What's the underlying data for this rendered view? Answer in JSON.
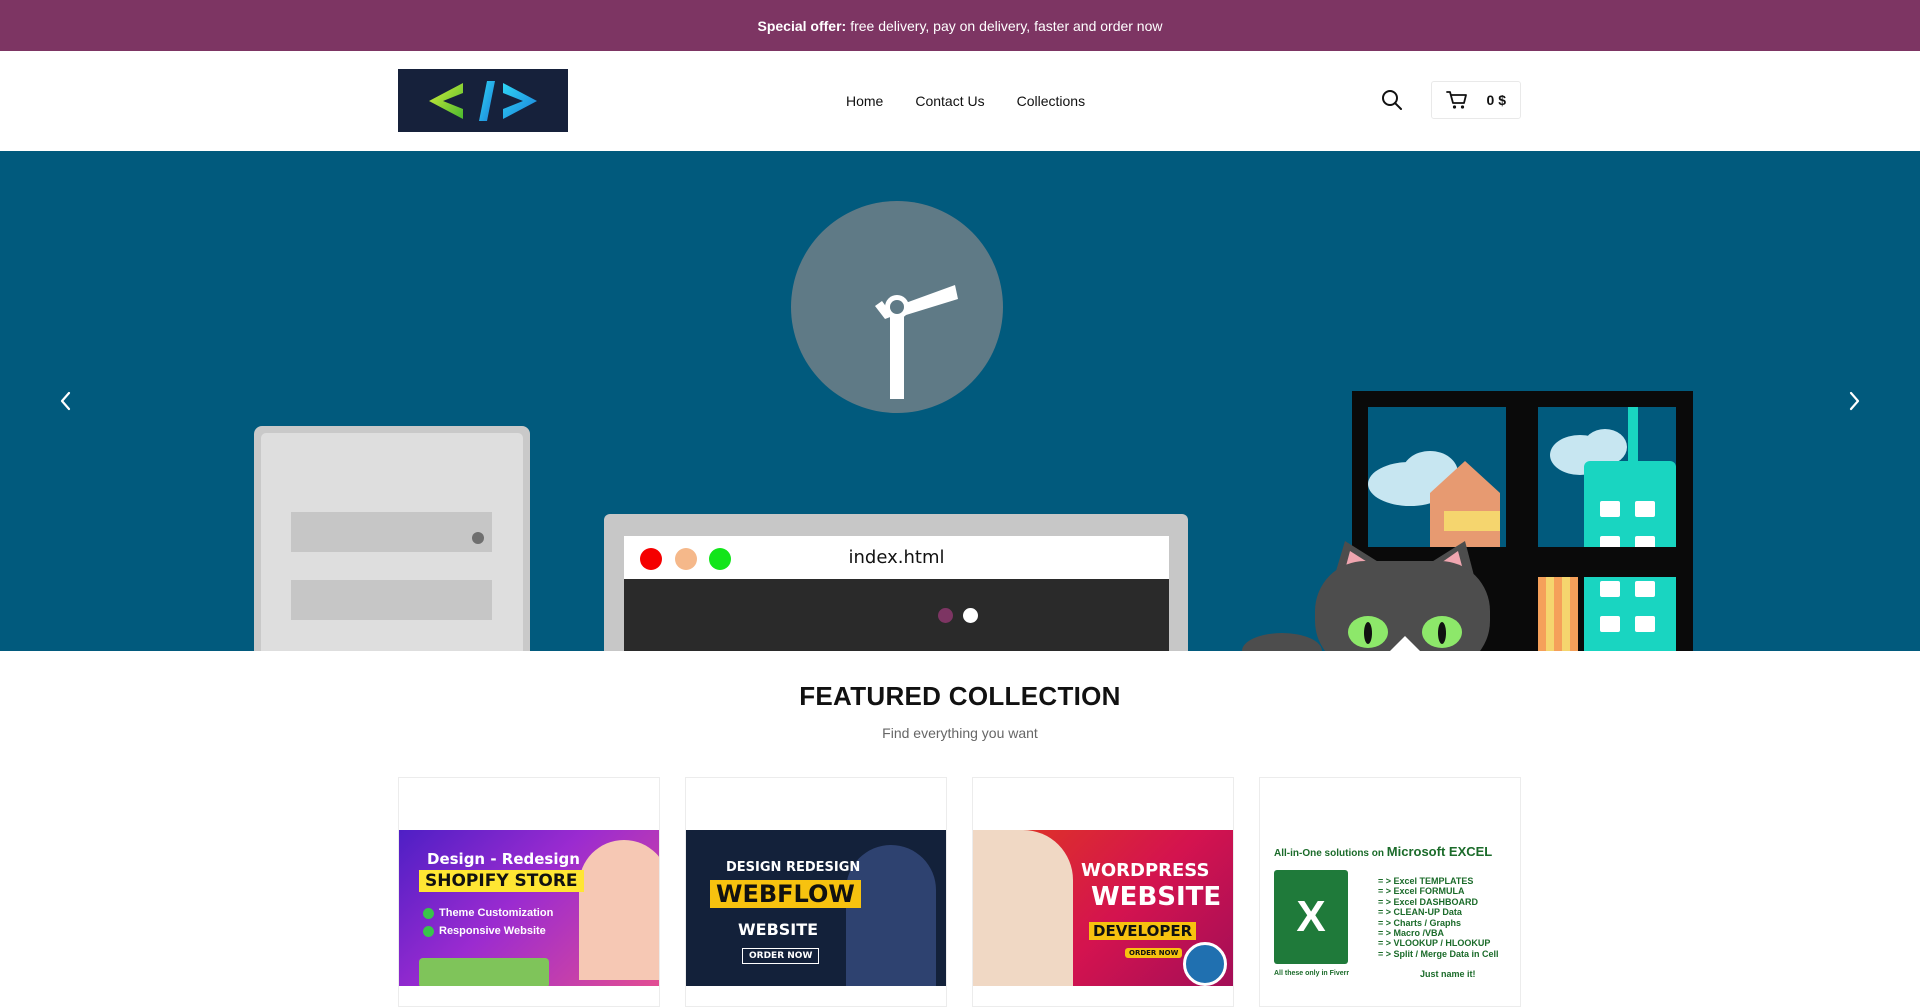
{
  "announcement": {
    "bold": "Special offer:",
    "text": "free delivery, pay on delivery, faster and order now"
  },
  "nav": {
    "home": "Home",
    "contact": "Contact Us",
    "collections": "Collections"
  },
  "cart": {
    "total": "0 $"
  },
  "hero": {
    "file_name": "index.html"
  },
  "featured": {
    "title": "FEATURED COLLECTION",
    "subtitle": "Find everything you want"
  },
  "products": [
    {
      "line1": "Design - Redesign",
      "line2": "SHOPIFY STORE",
      "bullet1": "Theme Customization",
      "bullet2": "Responsive Website"
    },
    {
      "line1": "DESIGN REDESIGN",
      "line2": "WEBFLOW",
      "line3": "WEBSITE",
      "cta": "ORDER NOW"
    },
    {
      "line1": "WORDPRESS",
      "line2": "WEBSITE",
      "line3": "DEVELOPER",
      "cta": "ORDER NOW"
    },
    {
      "header_pre": "All-in-One solutions on",
      "header_brand": "Microsoft EXCEL",
      "items": [
        "= > Excel TEMPLATES",
        "= > Excel FORMULA",
        "= > Excel DASHBOARD",
        "= > CLEAN-UP Data",
        "= > Charts / Graphs",
        "= > Macro /VBA",
        "= > VLOOKUP / HLOOKUP",
        "= > Split / Merge Data in Cell"
      ],
      "footer_left": "All these only in Fiverr",
      "footer_right": "Just name it!"
    }
  ],
  "colors": {
    "announcement_bg": "#7d3563",
    "hero_bg": "#015a7d",
    "active_dot": "#7d3563"
  }
}
